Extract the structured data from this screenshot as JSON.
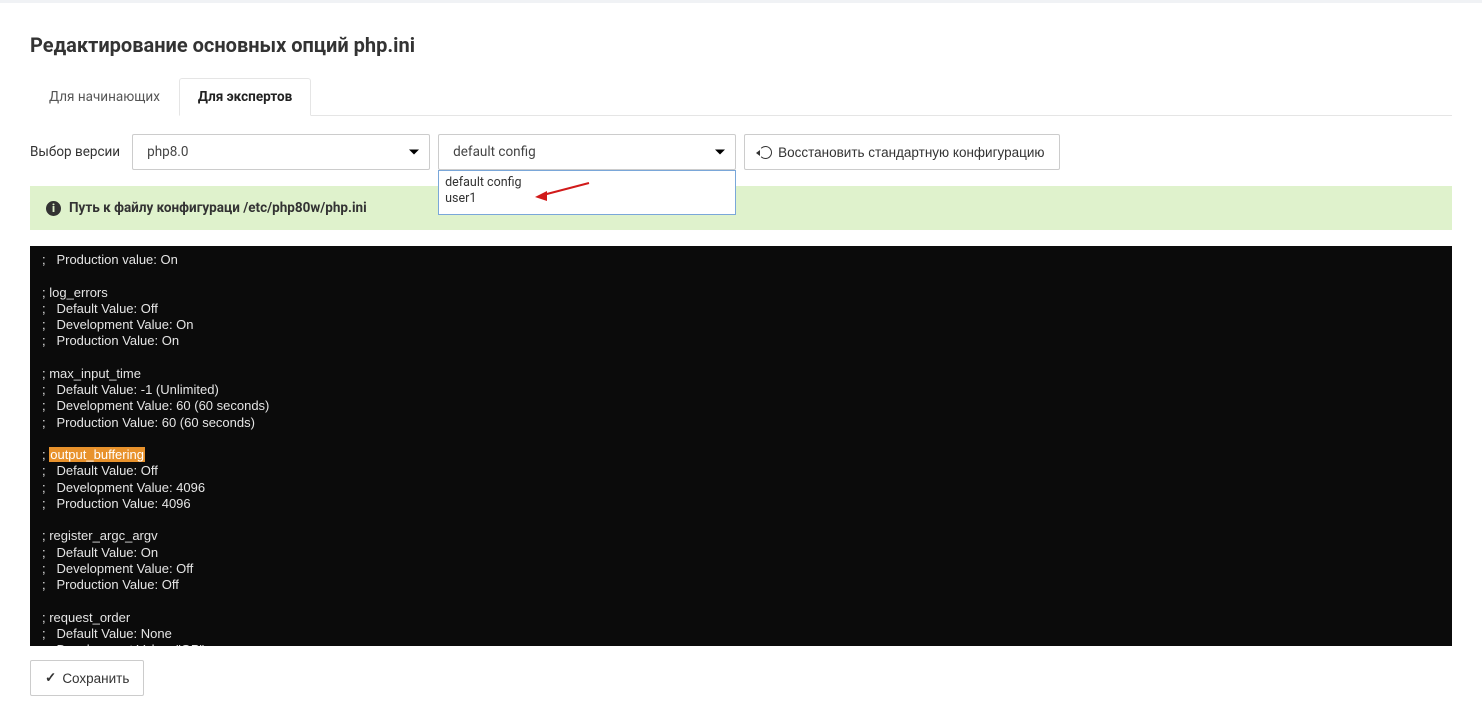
{
  "page": {
    "title": "Редактирование основных опций php.ini"
  },
  "tabs": {
    "beginner": "Для начинающих",
    "expert": "Для экспертов"
  },
  "controls": {
    "versionLabel": "Выбор версии",
    "versionValue": "php8.0",
    "configValue": "default config",
    "configOptions": [
      "default config",
      "user1"
    ],
    "restoreLabel": "Восстановить стандартную конфигурацию"
  },
  "alert": {
    "prefix": "Путь к файлу конфигураци ",
    "path": "/etc/php80w/php.ini"
  },
  "editor": {
    "lines": [
      ";   Production value: On",
      "",
      "; log_errors",
      ";   Default Value: Off",
      ";   Development Value: On",
      ";   Production Value: On",
      "",
      "; max_input_time",
      ";   Default Value: -1 (Unlimited)",
      ";   Development Value: 60 (60 seconds)",
      ";   Production Value: 60 (60 seconds)",
      "",
      "; output_buffering",
      ";   Default Value: Off",
      ";   Development Value: 4096",
      ";   Production Value: 4096",
      "",
      "; register_argc_argv",
      ";   Default Value: On",
      ";   Development Value: Off",
      ";   Production Value: Off",
      "",
      "; request_order",
      ";   Default Value: None",
      ";   Development Value: \"GP\""
    ],
    "highlightLineIndex": 12,
    "highlightText": "output_buffering"
  },
  "save": {
    "label": "Сохранить"
  }
}
